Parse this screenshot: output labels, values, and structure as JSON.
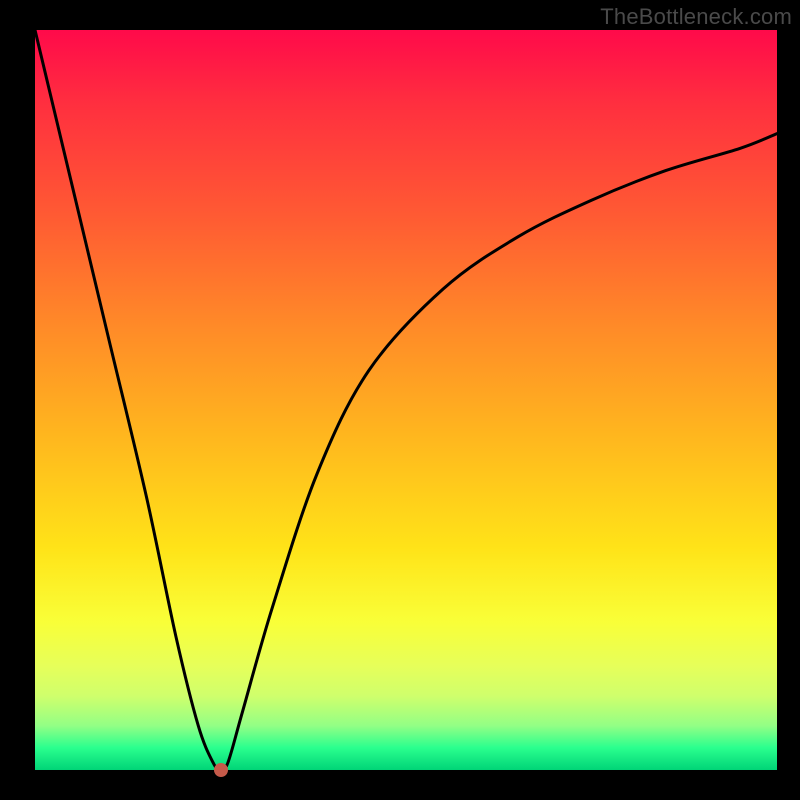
{
  "watermark": "TheBottleneck.com",
  "chart_data": {
    "type": "line",
    "title": "",
    "xlabel": "",
    "ylabel": "",
    "xlim": [
      0,
      100
    ],
    "ylim": [
      0,
      100
    ],
    "grid": false,
    "legend": false,
    "series": [
      {
        "name": "bottleneck-curve",
        "x": [
          0,
          5,
          10,
          15,
          19,
          22,
          24,
          25,
          26,
          28,
          32,
          38,
          45,
          55,
          65,
          75,
          85,
          95,
          100
        ],
        "values": [
          100,
          79,
          58,
          37,
          18,
          6,
          1,
          0,
          1,
          8,
          22,
          40,
          54,
          65,
          72,
          77,
          81,
          84,
          86
        ]
      }
    ],
    "annotations": [
      {
        "name": "minimum-marker",
        "x": 25,
        "y": 0,
        "color": "#c55a4a"
      }
    ],
    "background_gradient": {
      "top": "#ff0a4a",
      "mid": "#ffe318",
      "bottom": "#00d477"
    }
  }
}
